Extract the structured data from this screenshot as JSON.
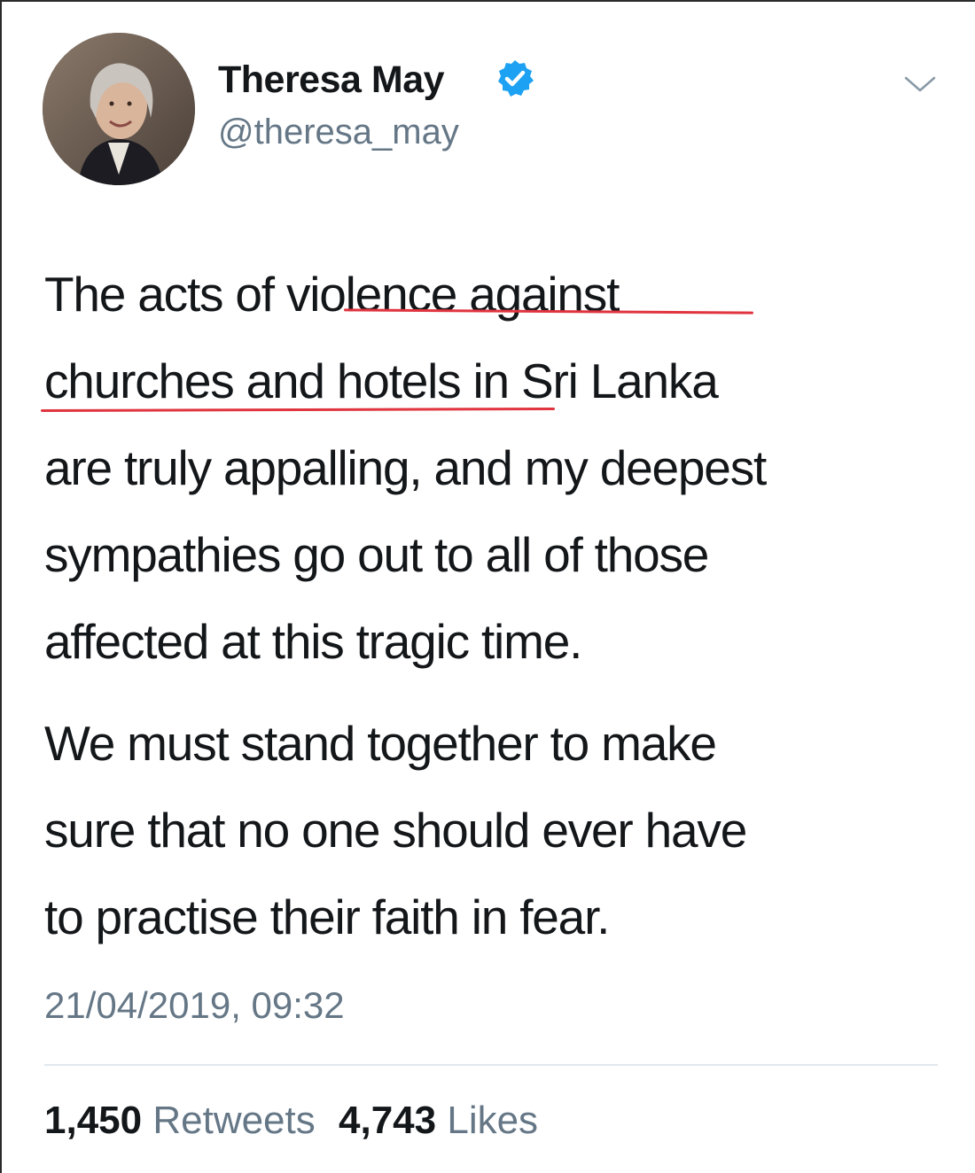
{
  "author": {
    "display_name": "Theresa May",
    "handle": "@theresa_may",
    "verified": true,
    "avatar_icon": "profile-photo"
  },
  "tweet": {
    "paragraph_1": [
      "The acts of violence against",
      "churches and hotels in Sri Lanka",
      "are truly appalling, and my deepest",
      "sympathies go out to all of those",
      "affected at this tragic time."
    ],
    "paragraph_2": [
      "We must stand together to make",
      "sure that no one should ever have",
      "to practise their faith in fear."
    ],
    "timestamp": "21/04/2019, 09:32"
  },
  "stats": {
    "retweets_count": "1,450",
    "retweets_label": "Retweets",
    "likes_count": "4,743",
    "likes_label": "Likes"
  },
  "colors": {
    "verified_badge": "#1da1f2",
    "secondary_text": "#657786",
    "annotation_underline": "#e0343f"
  }
}
